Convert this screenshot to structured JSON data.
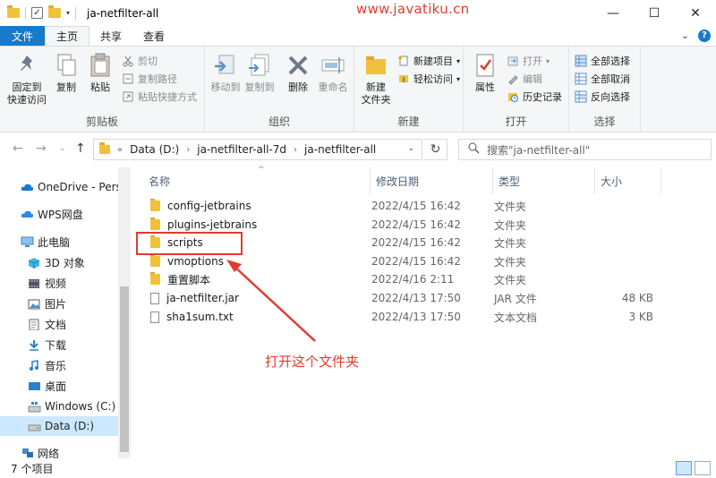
{
  "window": {
    "title": "ja-netfilter-all",
    "watermark": "www.javatiku.cn",
    "minimize": "—",
    "maximize": "☐",
    "close": "✕"
  },
  "tabs": [
    {
      "label": "文件"
    },
    {
      "label": "主页"
    },
    {
      "label": "共享"
    },
    {
      "label": "查看"
    }
  ],
  "ribbon": {
    "clipboard": {
      "label": "剪贴板",
      "pin": "固定到\n快速访问",
      "copy": "复制",
      "paste": "粘贴",
      "cut": "剪切",
      "copy_path": "复制路径",
      "paste_shortcut": "粘贴快捷方式"
    },
    "organize": {
      "label": "组织",
      "move_to": "移动到",
      "copy_to": "复制到",
      "delete": "删除",
      "rename": "重命名"
    },
    "new": {
      "label": "新建",
      "new_folder": "新建\n文件夹",
      "new_item": "新建项目",
      "easy_access": "轻松访问"
    },
    "open": {
      "label": "打开",
      "properties": "属性",
      "open": "打开",
      "edit": "编辑",
      "history": "历史记录"
    },
    "select": {
      "label": "选择",
      "select_all": "全部选择",
      "select_none": "全部取消",
      "invert": "反向选择"
    }
  },
  "address": {
    "overflow": "«",
    "crumbs": [
      "Data (D:)",
      "ja-netfilter-all-7d",
      "ja-netfilter-all"
    ],
    "search_placeholder": "搜索\"ja-netfilter-all\""
  },
  "sidebar": {
    "items": [
      {
        "label": "OneDrive - Perso"
      },
      {
        "label": "WPS网盘"
      },
      {
        "label": "此电脑"
      },
      {
        "label": "3D 对象"
      },
      {
        "label": "视频"
      },
      {
        "label": "图片"
      },
      {
        "label": "文档"
      },
      {
        "label": "下载"
      },
      {
        "label": "音乐"
      },
      {
        "label": "桌面"
      },
      {
        "label": "Windows (C:)"
      },
      {
        "label": "Data (D:)"
      },
      {
        "label": "网络"
      }
    ]
  },
  "columns": {
    "name": "名称",
    "date": "修改日期",
    "type": "类型",
    "size": "大小"
  },
  "files": [
    {
      "name": "config-jetbrains",
      "date": "2022/4/15 16:42",
      "type": "文件夹",
      "size": "",
      "kind": "folder"
    },
    {
      "name": "plugins-jetbrains",
      "date": "2022/4/15 16:42",
      "type": "文件夹",
      "size": "",
      "kind": "folder"
    },
    {
      "name": "scripts",
      "date": "2022/4/15 16:42",
      "type": "文件夹",
      "size": "",
      "kind": "folder"
    },
    {
      "name": "vmoptions",
      "date": "2022/4/15 16:42",
      "type": "文件夹",
      "size": "",
      "kind": "folder"
    },
    {
      "name": "重置脚本",
      "date": "2022/4/16 2:11",
      "type": "文件夹",
      "size": "",
      "kind": "folder"
    },
    {
      "name": "ja-netfilter.jar",
      "date": "2022/4/13 17:50",
      "type": "JAR 文件",
      "size": "48 KB",
      "kind": "file"
    },
    {
      "name": "sha1sum.txt",
      "date": "2022/4/13 17:50",
      "type": "文本文档",
      "size": "3 KB",
      "kind": "file"
    }
  ],
  "annotation": "打开这个文件夹",
  "status": {
    "count": "7 个项目"
  },
  "colors": {
    "accent": "#1979ca",
    "annotation": "#e23b2d",
    "folder": "#f0c23c"
  }
}
